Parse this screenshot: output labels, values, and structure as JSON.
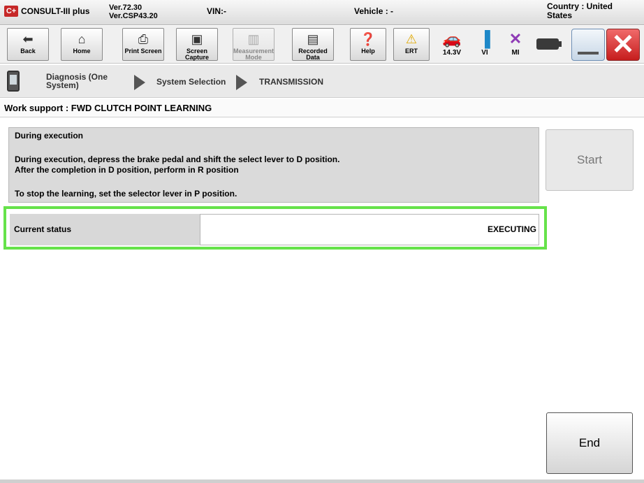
{
  "titlebar": {
    "logo": "C+",
    "app_name": "CONSULT-III plus",
    "version1": "Ver.72.30",
    "version2": "Ver.CSP43.20",
    "vin": "VIN:-",
    "vehicle": "Vehicle : -",
    "country": "Country : United States"
  },
  "toolbar": {
    "buttons": [
      {
        "label": "Back",
        "icon": "back-arrow-icon"
      },
      {
        "label": "Home",
        "icon": "home-icon"
      },
      {
        "label": "Print Screen",
        "icon": "printer-icon"
      },
      {
        "label": "Screen Capture",
        "icon": "camera-icon"
      },
      {
        "label": "Measurement Mode",
        "icon": "measurement-icon"
      },
      {
        "label": "Recorded Data",
        "icon": "recorded-data-icon"
      },
      {
        "label": "Help",
        "icon": "help-icon"
      },
      {
        "label": "ERT",
        "icon": "warning-icon"
      }
    ],
    "status": [
      {
        "label": "14.3V",
        "icon": "car-icon"
      },
      {
        "label": "VI",
        "icon": "signal-icon"
      },
      {
        "label": "MI",
        "icon": "x-mark-icon"
      }
    ]
  },
  "breadcrumb": {
    "item1": "Diagnosis (One System)",
    "item2": "System Selection",
    "item3": "TRANSMISSION"
  },
  "work_support": {
    "title": "Work support : FWD CLUTCH POINT LEARNING"
  },
  "panel": {
    "title": "During execution",
    "line1": "During execution, depress the brake pedal and shift the select lever to D position.",
    "line2": "After the completion in D position, perform in R position",
    "line3": "To stop the learning, set the selector lever in P position."
  },
  "buttons": {
    "start": "Start",
    "end": "End"
  },
  "status": {
    "label": "Current status",
    "value": "EXECUTING"
  },
  "colors": {
    "highlight": "#66e24a",
    "close": "#c61d1d"
  }
}
